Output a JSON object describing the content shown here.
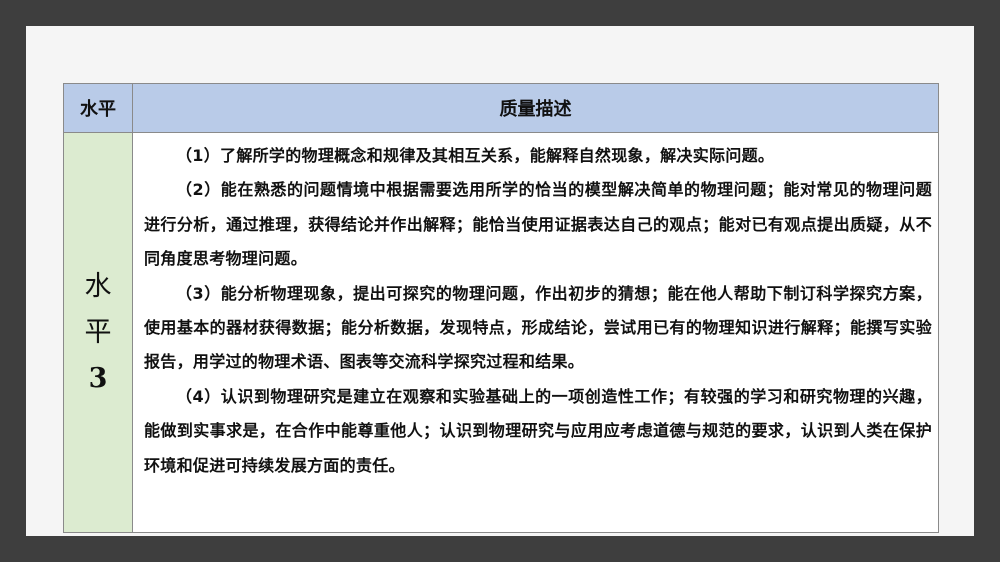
{
  "table": {
    "header": {
      "level": "水平",
      "description": "质量描述"
    },
    "level_label": {
      "char1": "水",
      "char2": "平",
      "number": "3"
    },
    "paragraphs": [
      "（1）了解所学的物理概念和规律及其相互关系，能解释自然现象，解决实际问题。",
      "（2）能在熟悉的问题情境中根据需要选用所学的恰当的模型解决简单的物理问题；能对常见的物理问题进行分析，通过推理，获得结论并作出解释；能恰当使用证据表达自己的观点；能对已有观点提出质疑，从不同角度思考物理问题。",
      "（3）能分析物理现象，提出可探究的物理问题，作出初步的猜想；能在他人帮助下制订科学探究方案，使用基本的器材获得数据；能分析数据，发现特点，形成结论，尝试用已有的物理知识进行解释；能撰写实验报告，用学过的物理术语、图表等交流科学探究过程和结果。",
      "（4）认识到物理研究是建立在观察和实验基础上的一项创造性工作；有较强的学习和研究物理的兴趣，能做到实事求是，在合作中能尊重他人；认识到物理研究与应用应考虑道德与规范的要求，认识到人类在保护环境和促进可持续发展方面的责任。"
    ]
  },
  "colors": {
    "header_bg": "#b9cbe8",
    "level_bg": "#dcebd0",
    "frame": "#3e3e3e"
  }
}
